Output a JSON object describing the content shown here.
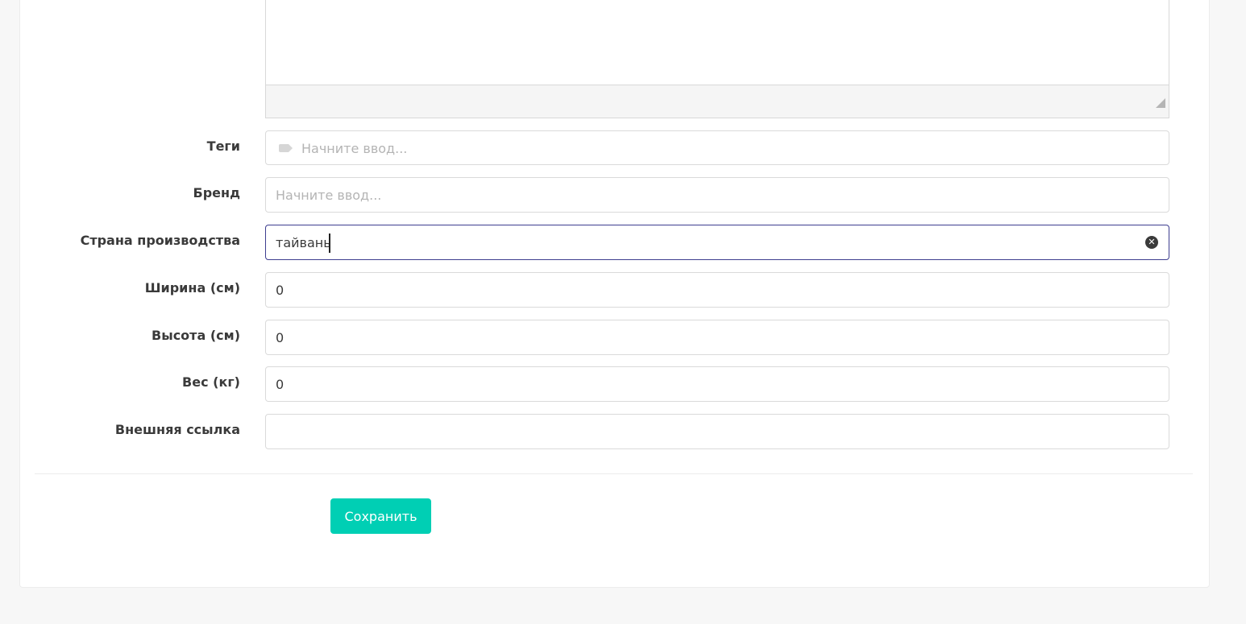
{
  "form": {
    "fields": [
      {
        "label": "Теги",
        "value": "",
        "placeholder": "Начните ввод..."
      },
      {
        "label": "Бренд",
        "value": "",
        "placeholder": "Начните ввод..."
      },
      {
        "label": "Страна производства",
        "value": "тайвань",
        "placeholder": ""
      },
      {
        "label": "Ширина (см)",
        "value": "0",
        "placeholder": ""
      },
      {
        "label": "Высота (см)",
        "value": "0",
        "placeholder": ""
      },
      {
        "label": "Вес (кг)",
        "value": "0",
        "placeholder": ""
      },
      {
        "label": "Внешняя ссылка",
        "value": "",
        "placeholder": ""
      }
    ],
    "save_label": "Сохранить"
  },
  "icons": {
    "tag": "tag-icon",
    "clear": "clear-circle-icon",
    "resize": "resize-handle-icon"
  },
  "colors": {
    "accent": "#00cfb4",
    "focus_border": "#3d3d8f"
  }
}
